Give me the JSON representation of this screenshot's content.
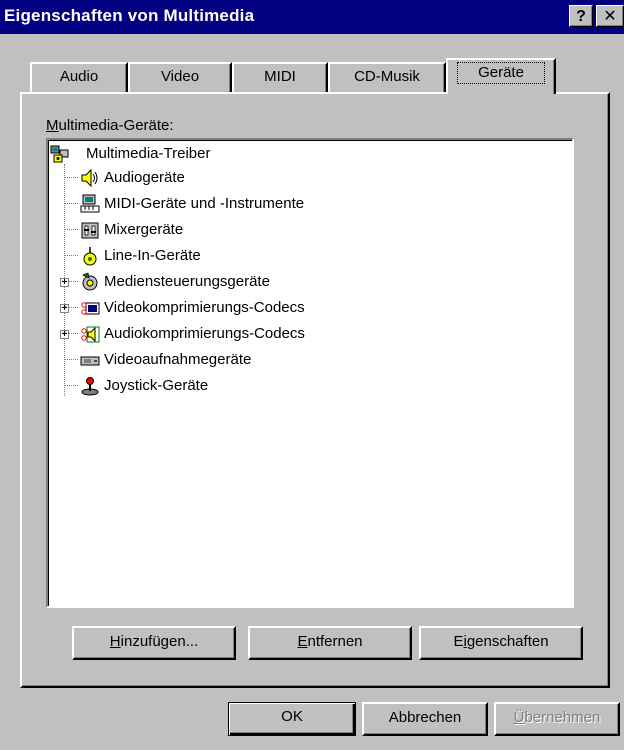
{
  "window": {
    "title": "Eigenschaften von Multimedia",
    "help_glyph": "?",
    "close_glyph": "✕"
  },
  "tabs": [
    {
      "label": "Audio",
      "active": false
    },
    {
      "label": "Video",
      "active": false
    },
    {
      "label": "MIDI",
      "active": false
    },
    {
      "label": "CD-Musik",
      "active": false
    },
    {
      "label": "Geräte",
      "active": true
    }
  ],
  "devices": {
    "group_label_accel": "M",
    "group_label_rest": "ultimedia-Geräte:",
    "root": {
      "label": "Multimedia-Treiber",
      "icon": "multimedia-drivers-icon"
    },
    "items": [
      {
        "label": "Audiogeräte",
        "icon": "speaker-icon",
        "expandable": false
      },
      {
        "label": "MIDI-Geräte und -Instrumente",
        "icon": "midi-icon",
        "expandable": false
      },
      {
        "label": "Mixergeräte",
        "icon": "mixer-icon",
        "expandable": false
      },
      {
        "label": "Line-In-Geräte",
        "icon": "line-in-icon",
        "expandable": false
      },
      {
        "label": "Mediensteuerungsgeräte",
        "icon": "media-control-icon",
        "expandable": true
      },
      {
        "label": "Videokomprimierungs-Codecs",
        "icon": "video-codec-icon",
        "expandable": true
      },
      {
        "label": "Audiokomprimierungs-Codecs",
        "icon": "audio-codec-icon",
        "expandable": true
      },
      {
        "label": "Videoaufnahmegeräte",
        "icon": "video-capture-icon",
        "expandable": false
      },
      {
        "label": "Joystick-Geräte",
        "icon": "joystick-icon",
        "expandable": false
      }
    ]
  },
  "panel_buttons": {
    "add_accel": "H",
    "add_rest": "inzufügen...",
    "remove_accel": "E",
    "remove_rest": "ntfernen",
    "props_pre": "E",
    "props_accel": "i",
    "props_rest": "genschaften"
  },
  "dialog_buttons": {
    "ok": "OK",
    "cancel": "Abbrechen",
    "apply_accel": "Ü",
    "apply_rest": "bernehmen",
    "apply_enabled": false
  }
}
